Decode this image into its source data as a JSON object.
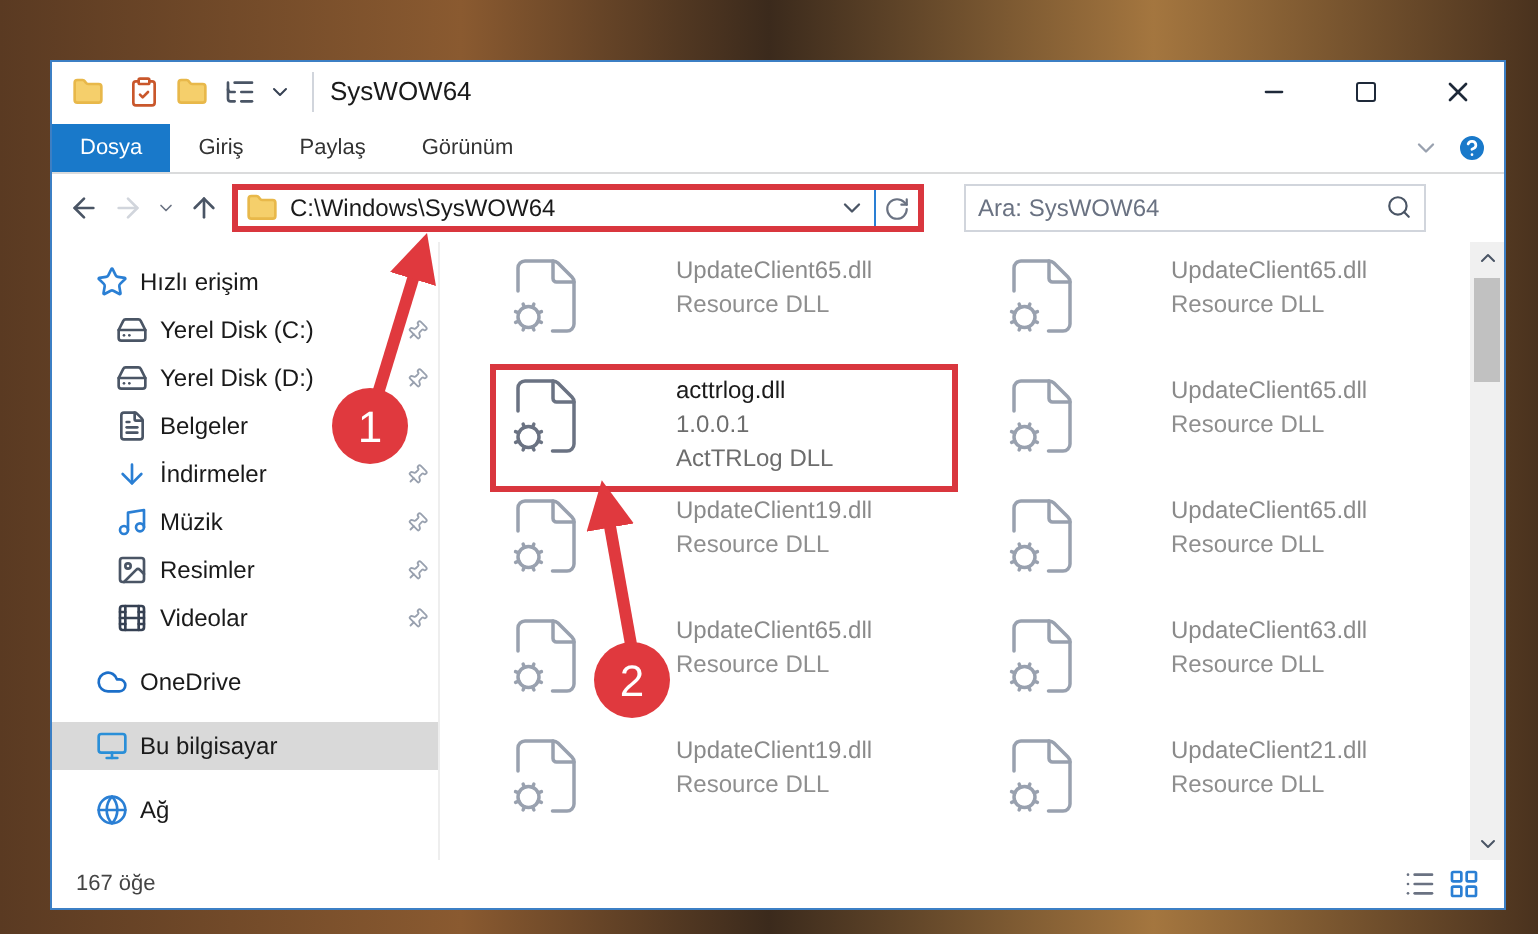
{
  "window": {
    "title": "SysWOW64"
  },
  "ribbon_tabs": [
    {
      "label": "Dosya",
      "selected": true
    },
    {
      "label": "Giriş",
      "selected": false
    },
    {
      "label": "Paylaş",
      "selected": false
    },
    {
      "label": "Görünüm",
      "selected": false
    }
  ],
  "address_bar": {
    "path": "C:\\Windows\\SysWOW64",
    "highlighted": true
  },
  "search": {
    "placeholder": "Ara: SysWOW64"
  },
  "sidebar": {
    "items": [
      {
        "label": "Hızlı erişim",
        "kind": "quick",
        "pinned": false,
        "selected": false
      },
      {
        "label": "Yerel Disk (C:)",
        "kind": "disk",
        "pinned": true,
        "selected": false
      },
      {
        "label": "Yerel Disk (D:)",
        "kind": "disk",
        "pinned": true,
        "selected": false
      },
      {
        "label": "Belgeler",
        "kind": "documents",
        "pinned": false,
        "selected": false
      },
      {
        "label": "İndirmeler",
        "kind": "downloads",
        "pinned": true,
        "selected": false
      },
      {
        "label": "Müzik",
        "kind": "music",
        "pinned": true,
        "selected": false
      },
      {
        "label": "Resimler",
        "kind": "pictures",
        "pinned": true,
        "selected": false
      },
      {
        "label": "Videolar",
        "kind": "videos",
        "pinned": true,
        "selected": false
      },
      {
        "label": "OneDrive",
        "kind": "cloud",
        "pinned": false,
        "selected": false
      },
      {
        "label": "Bu bilgisayar",
        "kind": "computer",
        "pinned": false,
        "selected": true
      },
      {
        "label": "Ağ",
        "kind": "network",
        "pinned": false,
        "selected": false
      }
    ]
  },
  "files": [
    {
      "name": "UpdateClient65.dll",
      "lines": [
        "Resource DLL"
      ],
      "highlighted": false
    },
    {
      "name": "UpdateClient65.dll",
      "lines": [
        "Resource DLL"
      ],
      "highlighted": false
    },
    {
      "name": "acttrlog.dll",
      "lines": [
        "1.0.0.1",
        "ActTRLog DLL"
      ],
      "highlighted": true
    },
    {
      "name": "UpdateClient65.dll",
      "lines": [
        "Resource DLL"
      ],
      "highlighted": false
    },
    {
      "name": "UpdateClient19.dll",
      "lines": [
        "Resource DLL"
      ],
      "highlighted": false
    },
    {
      "name": "UpdateClient65.dll",
      "lines": [
        "Resource DLL"
      ],
      "highlighted": false
    },
    {
      "name": "UpdateClient65.dll",
      "lines": [
        "Resource DLL"
      ],
      "highlighted": false
    },
    {
      "name": "UpdateClient63.dll",
      "lines": [
        "Resource DLL"
      ],
      "highlighted": false
    },
    {
      "name": "UpdateClient19.dll",
      "lines": [
        "Resource DLL"
      ],
      "highlighted": false
    },
    {
      "name": "UpdateClient21.dll",
      "lines": [
        "Resource DLL"
      ],
      "highlighted": false
    }
  ],
  "status_bar": {
    "count": "167 öğe"
  },
  "callouts": [
    {
      "number": "1"
    },
    {
      "number": "2"
    }
  ]
}
